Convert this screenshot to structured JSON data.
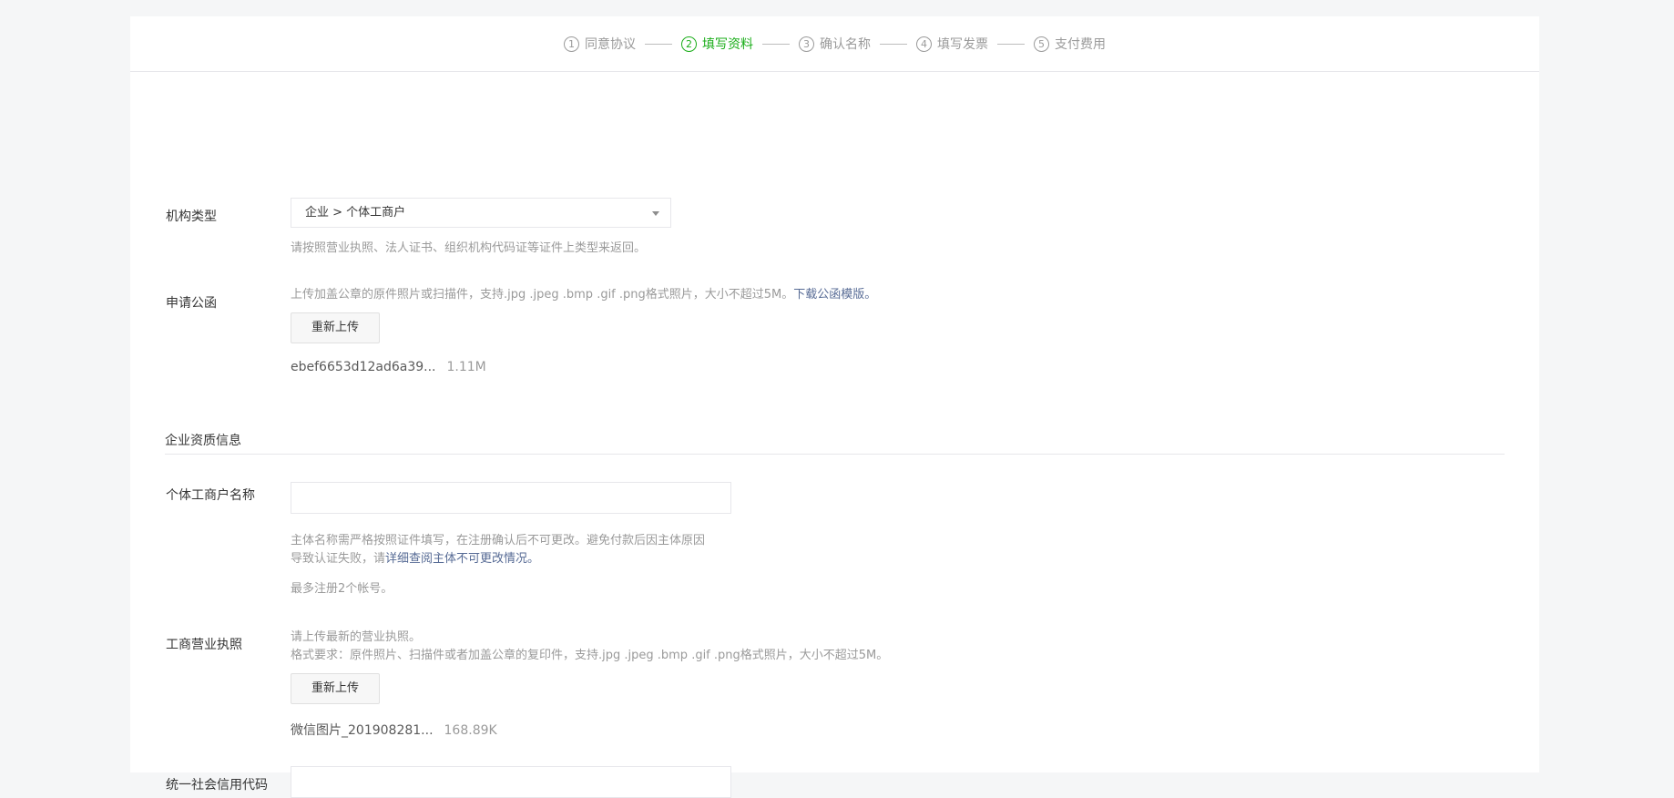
{
  "steps": [
    {
      "num": "1",
      "label": "同意协议",
      "active": false
    },
    {
      "num": "2",
      "label": "填写资料",
      "active": true
    },
    {
      "num": "3",
      "label": "确认名称",
      "active": false
    },
    {
      "num": "4",
      "label": "填写发票",
      "active": false
    },
    {
      "num": "5",
      "label": "支付费用",
      "active": false
    }
  ],
  "org_type": {
    "label": "机构类型",
    "value": "企业 > 个体工商户",
    "tip": "请按照营业执照、法人证书、组织机构代码证等证件上类型来返回。"
  },
  "letter": {
    "label": "申请公函",
    "tip": "上传加盖公章的原件照片或扫描件，支持.jpg .jpeg .bmp .gif .png格式照片，大小不超过5M。",
    "tip_link": "下载公函模版。",
    "button": "重新上传",
    "file_name": "ebef6653d12ad6a39...",
    "file_size": "1.11M"
  },
  "section_title": "企业资质信息",
  "business_name": {
    "label": "个体工商户名称",
    "value": "",
    "tip_line1": "主体名称需严格按照证件填写，在注册确认后不可更改。避免付款后因主体原因",
    "tip_line2_prefix": "导致认证失败，请",
    "tip_line2_link": "详细查阅主体不可更改情况。",
    "tip_limit": "最多注册2个帐号。"
  },
  "license": {
    "label": "工商营业执照",
    "tip_line1": "请上传最新的营业执照。",
    "tip_line2": "格式要求：原件照片、扫描件或者加盖公章的复印件，支持.jpg .jpeg .bmp .gif .png格式照片，大小不超过5M。",
    "button": "重新上传",
    "file_name": "微信图片_201908281...",
    "file_size": "168.89K"
  },
  "credit_code": {
    "label": "统一社会信用代码",
    "value": ""
  }
}
